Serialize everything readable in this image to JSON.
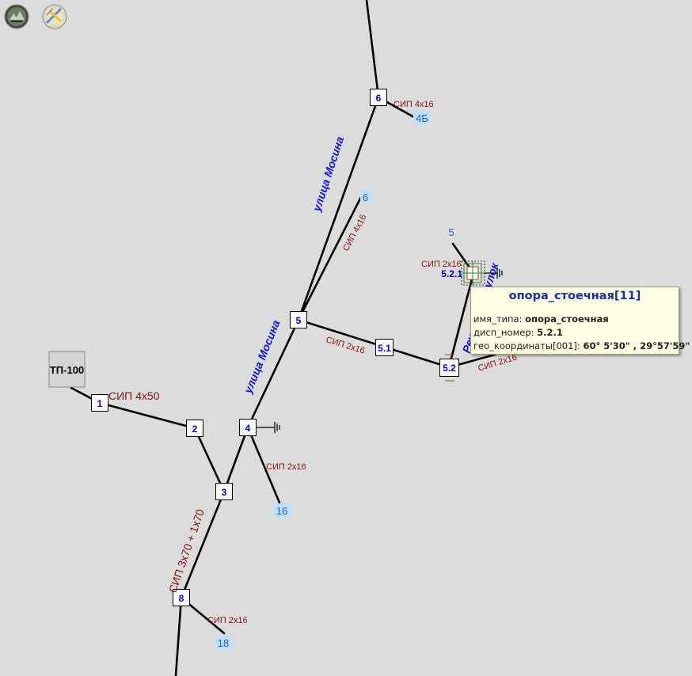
{
  "toolbar": {
    "buttons": [
      {
        "name": "satellite-view-icon"
      },
      {
        "name": "map-layer-icon"
      }
    ]
  },
  "substation": {
    "label": "ТП-100"
  },
  "nodes": [
    {
      "id": "n1",
      "label": "1"
    },
    {
      "id": "n2",
      "label": "2"
    },
    {
      "id": "n3",
      "label": "3"
    },
    {
      "id": "n4",
      "label": "4"
    },
    {
      "id": "n5",
      "label": "5"
    },
    {
      "id": "n51",
      "label": "5.1"
    },
    {
      "id": "n52",
      "label": "5.2"
    },
    {
      "id": "n6",
      "label": "6"
    },
    {
      "id": "n8",
      "label": "8"
    }
  ],
  "selected_node": {
    "label": "5.2.1"
  },
  "houses": [
    {
      "id": "h4b",
      "label": "4Б"
    },
    {
      "id": "h6",
      "label": "6"
    },
    {
      "id": "h5",
      "label": "5"
    },
    {
      "id": "h16",
      "label": "16"
    },
    {
      "id": "h18",
      "label": "18"
    }
  ],
  "cable_labels": [
    {
      "id": "c1",
      "label": "СИП 4х50"
    },
    {
      "id": "c2",
      "label": "СИП 4х16"
    },
    {
      "id": "c3",
      "label": "СИП 4х16"
    },
    {
      "id": "c4",
      "label": "СИП 2х16"
    },
    {
      "id": "c5",
      "label": "СИП 2х16"
    },
    {
      "id": "c6",
      "label": "СИП 2х16"
    },
    {
      "id": "c7",
      "label": "СИП 2х16"
    },
    {
      "id": "c8",
      "label": "СИП 2х16"
    },
    {
      "id": "c9",
      "label": "СИП 3х70 + 1х70"
    }
  ],
  "streets": [
    {
      "id": "s1",
      "label": "улица Мосина"
    },
    {
      "id": "s2",
      "label": "улица Мосина"
    },
    {
      "id": "s3",
      "label": "Речной переулок"
    }
  ],
  "tooltip": {
    "title": "опора_стоечная[11]",
    "rows": [
      {
        "key": "имя_типа",
        "value": "опора_стоечная"
      },
      {
        "key": "дисп_номер",
        "value": "5.2.1"
      },
      {
        "key": "гео_координаты[001]",
        "value": "60° 5'30\" , 29°57'59\""
      }
    ]
  },
  "colors": {
    "background": "#dcdcdc",
    "line": "#000000",
    "node_label": "#0000cc",
    "house_label": "#1a5fd0",
    "house_bg": "#bfe0ff",
    "cable_label": "#8b1010",
    "street_label": "#1010e0",
    "tooltip_bg": "#ffffe3",
    "tooltip_title": "#1a2fa0"
  }
}
